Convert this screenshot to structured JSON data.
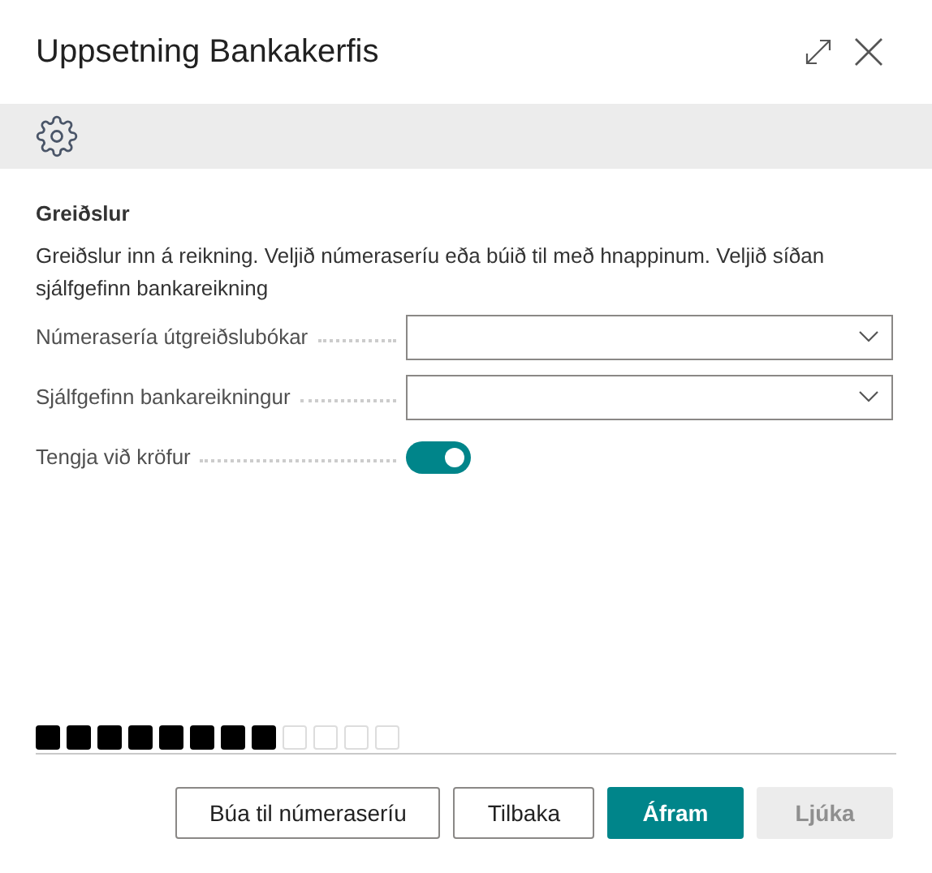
{
  "window": {
    "title": "Uppsetning Bankakerfis"
  },
  "section": {
    "title": "Greiðslur",
    "description": "Greiðslur inn á reikning. Veljið númeraseríu eða búið til með hnappinum. Veljið síðan sjálfgefinn bankareikning"
  },
  "fields": [
    {
      "kind": "dropdown",
      "label": "Númerasería útgreiðslubókar"
    },
    {
      "kind": "dropdown",
      "label": "Sjálfgefinn bankareikningur"
    },
    {
      "kind": "toggle",
      "label": "Tengja við kröfur",
      "on": true
    }
  ],
  "steps": [
    {
      "done": true
    },
    {
      "done": true
    },
    {
      "done": true
    },
    {
      "done": true
    },
    {
      "done": true
    },
    {
      "done": true
    },
    {
      "done": true
    },
    {
      "done": true
    },
    {
      "done": false
    },
    {
      "done": false
    },
    {
      "done": false
    },
    {
      "done": false
    }
  ],
  "buttons": [
    {
      "label": "Búa til númeraseríu",
      "primary": false,
      "disabled": false
    },
    {
      "label": "Tilbaka",
      "primary": false,
      "disabled": false
    },
    {
      "label": "Áfram",
      "primary": true,
      "disabled": false
    },
    {
      "label": "Ljúka",
      "primary": false,
      "disabled": true
    }
  ]
}
